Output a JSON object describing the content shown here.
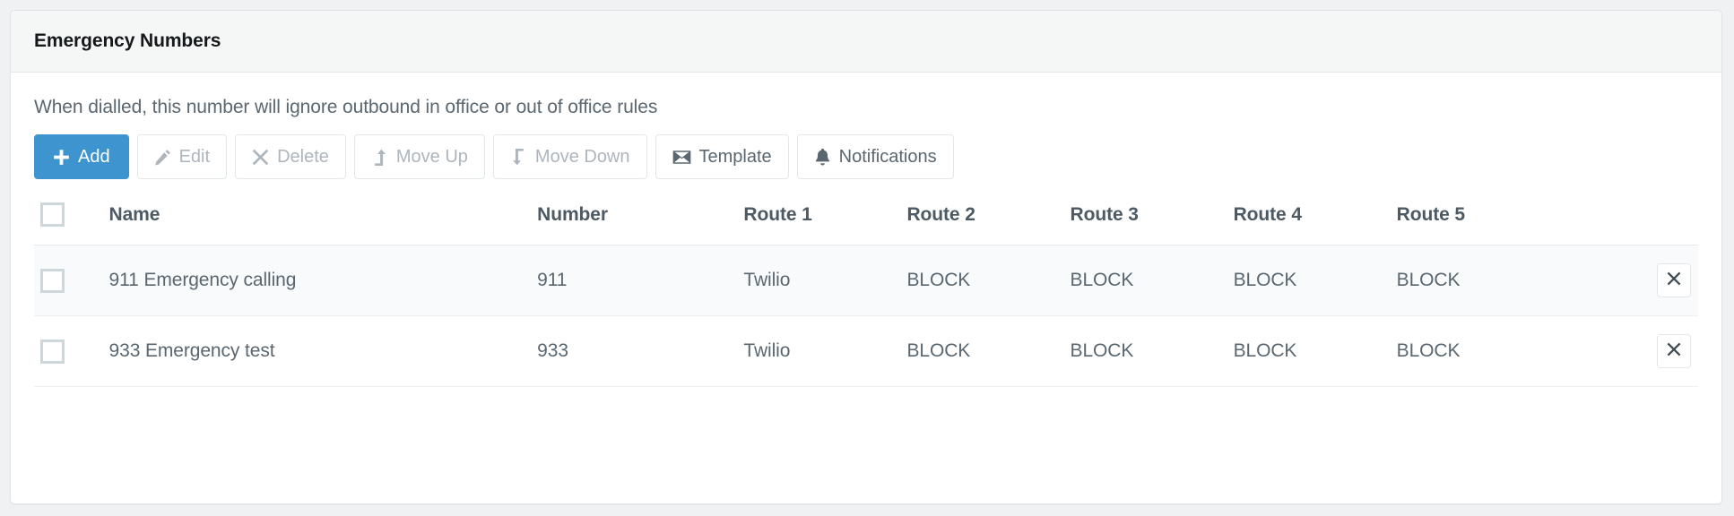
{
  "panel": {
    "title": "Emergency Numbers",
    "description": "When dialled, this number will ignore outbound in office or out of office rules"
  },
  "toolbar": {
    "buttons": [
      {
        "label": "Add",
        "icon": "plus-icon",
        "state": "primary"
      },
      {
        "label": "Edit",
        "icon": "pencil-icon",
        "state": "disabled"
      },
      {
        "label": "Delete",
        "icon": "times-icon",
        "state": "disabled"
      },
      {
        "label": "Move Up",
        "icon": "level-up-icon",
        "state": "disabled"
      },
      {
        "label": "Move Down",
        "icon": "level-down-icon",
        "state": "disabled"
      },
      {
        "label": "Template",
        "icon": "envelope-icon",
        "state": "default"
      },
      {
        "label": "Notifications",
        "icon": "bell-icon",
        "state": "default"
      }
    ]
  },
  "table": {
    "headers": {
      "select_all": "",
      "name": "Name",
      "number": "Number",
      "route1": "Route 1",
      "route2": "Route 2",
      "route3": "Route 3",
      "route4": "Route 4",
      "route5": "Route 5"
    },
    "row_delete_icon": "times-icon",
    "rows": [
      {
        "name": "911 Emergency calling",
        "number": "911",
        "route1": "Twilio",
        "route2": "BLOCK",
        "route3": "BLOCK",
        "route4": "BLOCK",
        "route5": "BLOCK",
        "selected": false
      },
      {
        "name": "933 Emergency test",
        "number": "933",
        "route1": "Twilio",
        "route2": "BLOCK",
        "route3": "BLOCK",
        "route4": "BLOCK",
        "route5": "BLOCK",
        "selected": false
      }
    ]
  },
  "colors": {
    "primary": "#3e94ce",
    "panel_header_bg": "#f5f7f7",
    "text": "#5b6770",
    "header_text": "#4d5a63",
    "disabled_text": "#adb5bd",
    "border": "#e2e7e9",
    "stripe": "#f8fafb",
    "page_bg": "#eff1f3"
  }
}
